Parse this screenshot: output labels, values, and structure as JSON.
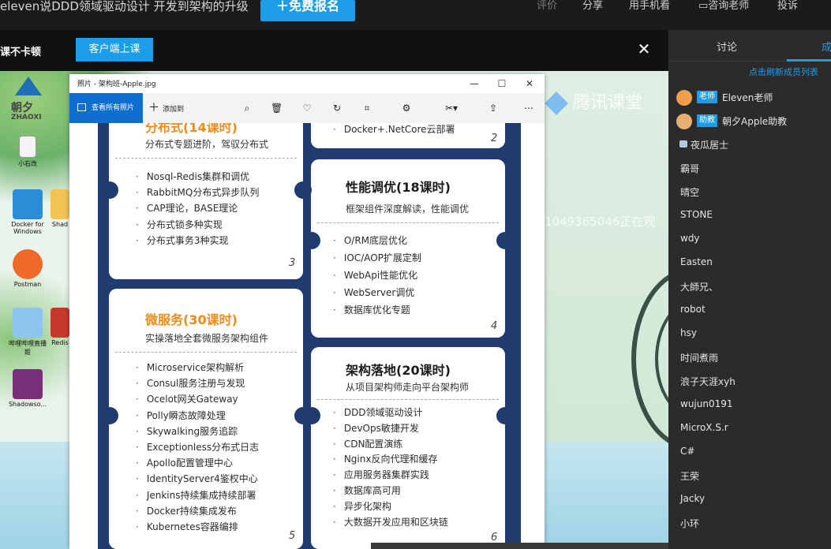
{
  "topbar": {
    "course_title": "eleven说DDD领域驱动设计 开发到架构的升级",
    "signup_label": "＋免费报名",
    "nav": [
      "评价",
      "分享",
      "用手机看",
      "咨询老师",
      "投诉"
    ]
  },
  "notice": {
    "text": "课不卡顿",
    "client_button": "客户端上课",
    "close_label": "✕"
  },
  "video": {
    "platform_text": "腾讯课堂",
    "watermark": "1049365046正在观",
    "logo_text": "朝夕",
    "logo_sub": "ZHAOXI",
    "desktop_icons": [
      "小右改",
      "Docker for Windows",
      "Shad",
      "Postman",
      "哔哩哔哩直播姬",
      "Redis",
      "Shadowso..."
    ]
  },
  "photo_viewer": {
    "window_title": "照片 - 架构班-Apple.jpg",
    "window_controls": [
      "—",
      "☐",
      "✕"
    ],
    "see_all_label": "查看所有照片",
    "add_to_label": "添加到",
    "toolbar_icons": [
      "zoom-icon",
      "delete-icon",
      "favorite-icon",
      "rotate-icon",
      "crop-icon",
      "enhance-icon",
      "edit-icon",
      "share-icon",
      "more-icon"
    ],
    "cards": [
      {
        "title": "分布式(14课时)",
        "subtitle": "分布式专题进阶，驾驭分布式",
        "items": [
          "Nosql-Redis集群和调优",
          "RabbitMQ分布式异步队列",
          "CAP理论，BASE理论",
          "分布式锁多种实现",
          "分布式事务3种实现"
        ],
        "number": "3"
      },
      {
        "title": "",
        "subtitle": "",
        "items": [
          "Docker+.NetCore云部署"
        ],
        "number": "2"
      },
      {
        "title": "性能调优(18课时)",
        "subtitle": "框架组件深度解读，性能调优",
        "items": [
          "O/RM底层优化",
          "IOC/AOP扩展定制",
          "WebApi性能优化",
          "WebServer调优",
          "数据库优化专题"
        ],
        "number": "4"
      },
      {
        "title": "微服务(30课时)",
        "subtitle": "实操落地全套微服务架构组件",
        "items": [
          "Microservice架构解析",
          "Consul服务注册与发现",
          "Ocelot网关Gateway",
          "Polly瞬态故障处理",
          "Skywalking服务追踪",
          "Exceptionless分布式日志",
          "Apollo配置管理中心",
          "IdentityServer4鉴权中心",
          "Jenkins持续集成持续部署",
          "Docker持续集成发布",
          "Kubernetes容器编排"
        ],
        "number": "5"
      },
      {
        "title": "架构落地(20课时)",
        "subtitle": "从项目架构师走向平台架构师",
        "items": [
          "DDD领域驱动设计",
          "DevOps敏捷开发",
          "CDN配置演练",
          "Nginx反向代理和缓存",
          "应用服务器集群实践",
          "数据库高可用",
          "异步化架构",
          "大数据开发应用和区块链"
        ],
        "number": "6"
      }
    ]
  },
  "sidepanel": {
    "tabs": [
      "讨论",
      "成"
    ],
    "refresh_link": "点击刷新成员列表",
    "members": [
      {
        "badge": "老师",
        "name": "Eleven老师"
      },
      {
        "badge": "助教",
        "name": "朝夕Apple助教"
      },
      {
        "badge": "",
        "name": "夜瓜居士"
      },
      {
        "badge": "",
        "name": "霸哥"
      },
      {
        "badge": "",
        "name": "晴空"
      },
      {
        "badge": "",
        "name": "STONE"
      },
      {
        "badge": "",
        "name": "wdy"
      },
      {
        "badge": "",
        "name": "Easten"
      },
      {
        "badge": "",
        "name": "大師兄、"
      },
      {
        "badge": "",
        "name": "robot"
      },
      {
        "badge": "",
        "name": "hsy"
      },
      {
        "badge": "",
        "name": "时间煮雨"
      },
      {
        "badge": "",
        "name": "浪子天涯xyh"
      },
      {
        "badge": "",
        "name": "wujun0191"
      },
      {
        "badge": "",
        "name": "MicroX.S.r"
      },
      {
        "badge": "",
        "name": "C#"
      },
      {
        "badge": "",
        "name": "王荣"
      },
      {
        "badge": "",
        "name": "Jacky"
      },
      {
        "badge": "",
        "name": "小环"
      }
    ]
  },
  "colors": {
    "accent": "#1f9ce8",
    "dark_bg": "#1b1b1c",
    "panel_bg": "#2b2b2c",
    "image_navy": "#1f3b6f",
    "orange": "#ef8a17"
  }
}
